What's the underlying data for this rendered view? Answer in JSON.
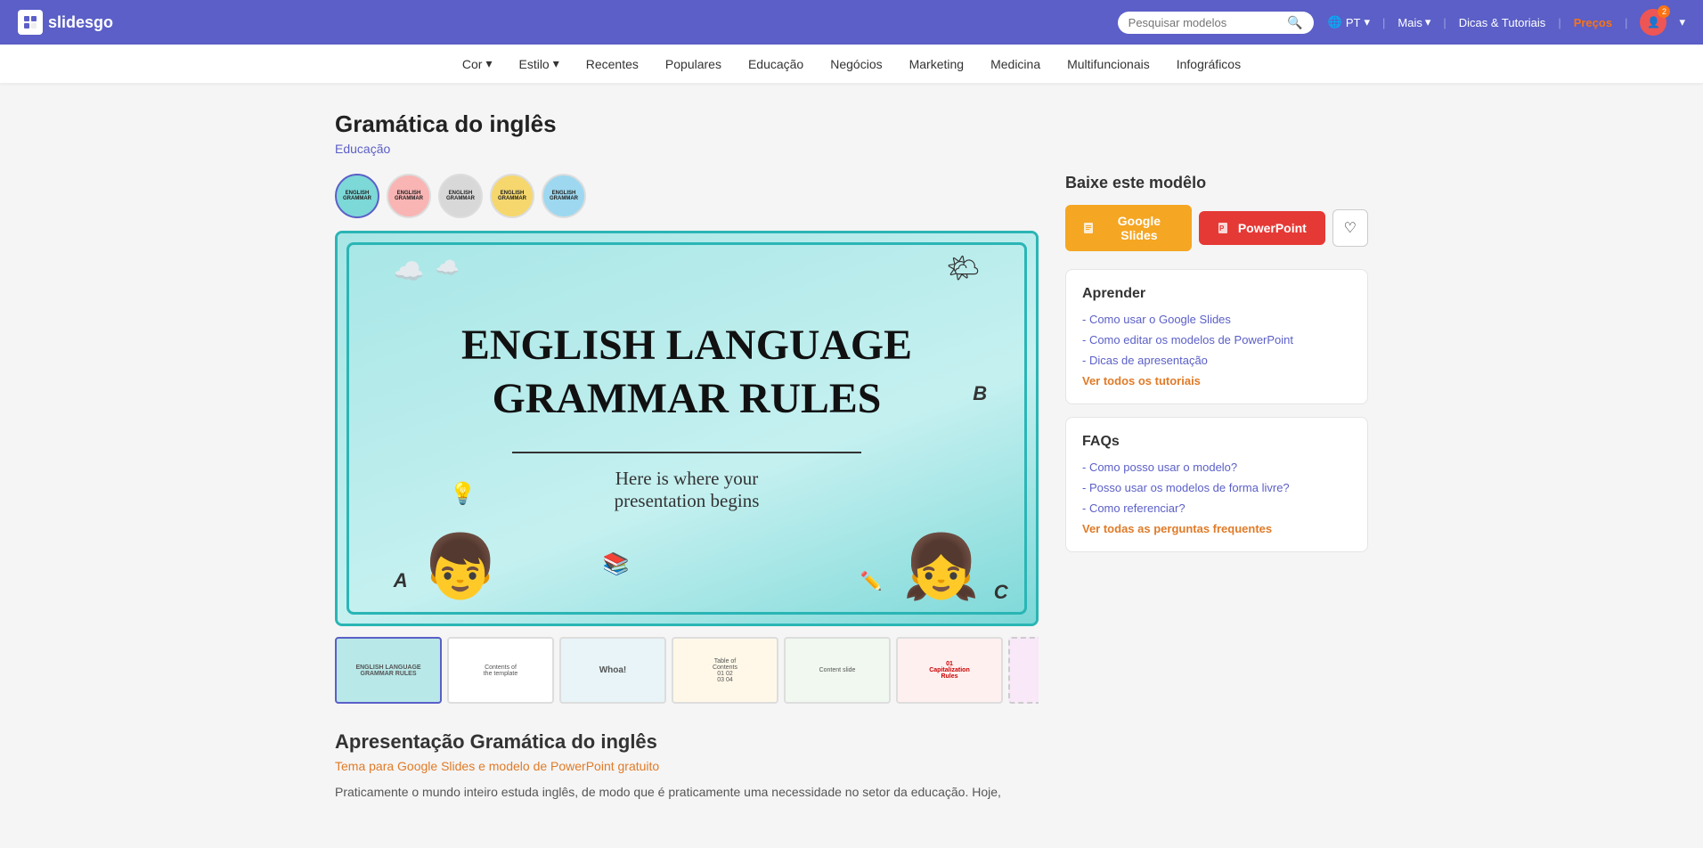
{
  "header": {
    "logo_text": "slidesgo",
    "search_placeholder": "Pesquisar modelos",
    "lang": "PT",
    "nav_items": [
      {
        "label": "Mais",
        "has_arrow": true
      },
      {
        "label": "Dicas & Tutoriais"
      },
      {
        "label": "Preços",
        "highlight": true
      }
    ],
    "notification_count": "2"
  },
  "subnav": {
    "items": [
      {
        "label": "Cor",
        "has_arrow": true
      },
      {
        "label": "Estilo",
        "has_arrow": true
      },
      {
        "label": "Recentes"
      },
      {
        "label": "Populares"
      },
      {
        "label": "Educação"
      },
      {
        "label": "Negócios"
      },
      {
        "label": "Marketing"
      },
      {
        "label": "Medicina"
      },
      {
        "label": "Multifuncionais"
      },
      {
        "label": "Infográficos"
      }
    ]
  },
  "page": {
    "title": "Gramática do inglês",
    "category": "Educação",
    "slide_title": "English Language\nGrammar Rules",
    "slide_subtitle": "Here is where your\npresentation begins",
    "variants": [
      {
        "id": 1,
        "color": "#5dd4d4",
        "active": true
      },
      {
        "id": 2,
        "color": "#f97575"
      },
      {
        "id": 3,
        "color": "#cccccc"
      },
      {
        "id": 4,
        "color": "#f5d76e"
      },
      {
        "id": 5,
        "color": "#7ec8e3"
      }
    ]
  },
  "download": {
    "title": "Baixe este modêlo",
    "google_slides_label": "Google Slides",
    "powerpoint_label": "PowerPoint",
    "favorite_icon": "♡"
  },
  "learn": {
    "title": "Aprender",
    "links": [
      {
        "label": "- Como usar o Google Slides"
      },
      {
        "label": "- Como editar os modelos de PowerPoint"
      },
      {
        "label": "- Dicas de apresentação"
      }
    ],
    "see_all_label": "Ver todos os tutoriais"
  },
  "faqs": {
    "title": "FAQs",
    "links": [
      {
        "label": "- Como posso usar o modelo?"
      },
      {
        "label": "- Posso usar os modelos de forma livre?"
      },
      {
        "label": "- Como referenciar?"
      }
    ],
    "see_all_label": "Ver todas as perguntas frequentes"
  },
  "description": {
    "title": "Apresentação Gramática do inglês",
    "subtitle": "Tema para Google Slides e modelo de PowerPoint gratuito",
    "text": "Praticamente o mundo inteiro estuda inglês, de modo que é praticamente uma necessidade no setor da educação. Hoje,"
  }
}
